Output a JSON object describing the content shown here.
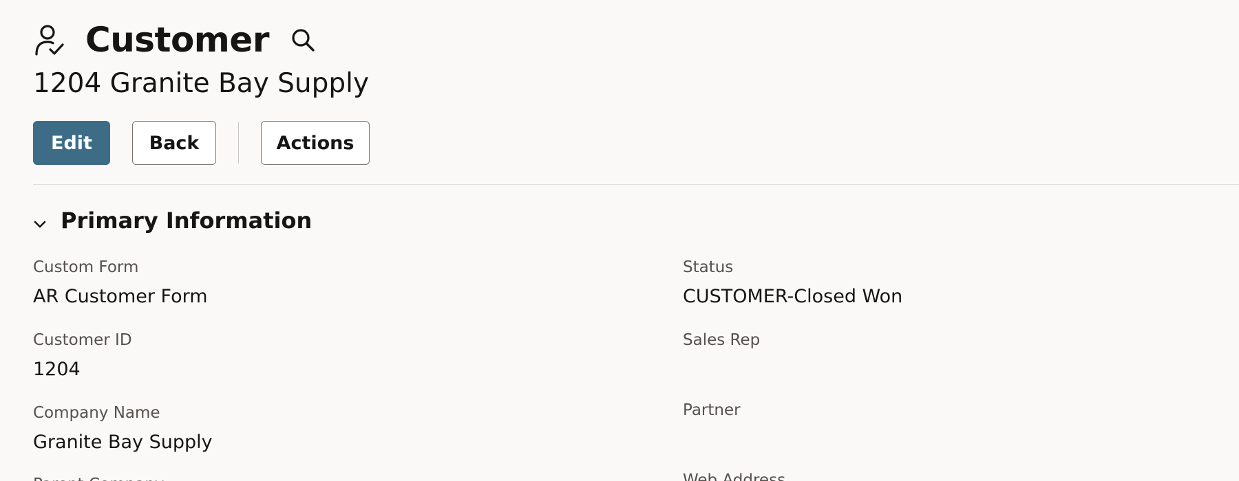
{
  "header": {
    "title": "Customer",
    "record_name": "1204 Granite Bay Supply",
    "icons": {
      "record": "user-check-icon",
      "search": "search-icon"
    }
  },
  "toolbar": {
    "edit_label": "Edit",
    "back_label": "Back",
    "actions_label": "Actions"
  },
  "colors": {
    "primary_button": "#3d6d86",
    "background": "#faf9f8",
    "text": "#161513",
    "label_text": "#55514d"
  },
  "section": {
    "title": "Primary Information",
    "expanded": true,
    "icon": "chevron-down-icon"
  },
  "fields": {
    "custom_form": {
      "label": "Custom Form",
      "value": "AR Customer Form"
    },
    "customer_id": {
      "label": "Customer ID",
      "value": "1204"
    },
    "company_name": {
      "label": "Company Name",
      "value": "Granite Bay Supply"
    },
    "parent_company": {
      "label": "Parent Company",
      "value": ""
    },
    "status": {
      "label": "Status",
      "value": "CUSTOMER-Closed Won"
    },
    "sales_rep": {
      "label": "Sales Rep",
      "value": ""
    },
    "partner": {
      "label": "Partner",
      "value": ""
    },
    "web_address": {
      "label": "Web Address",
      "value": ""
    }
  }
}
